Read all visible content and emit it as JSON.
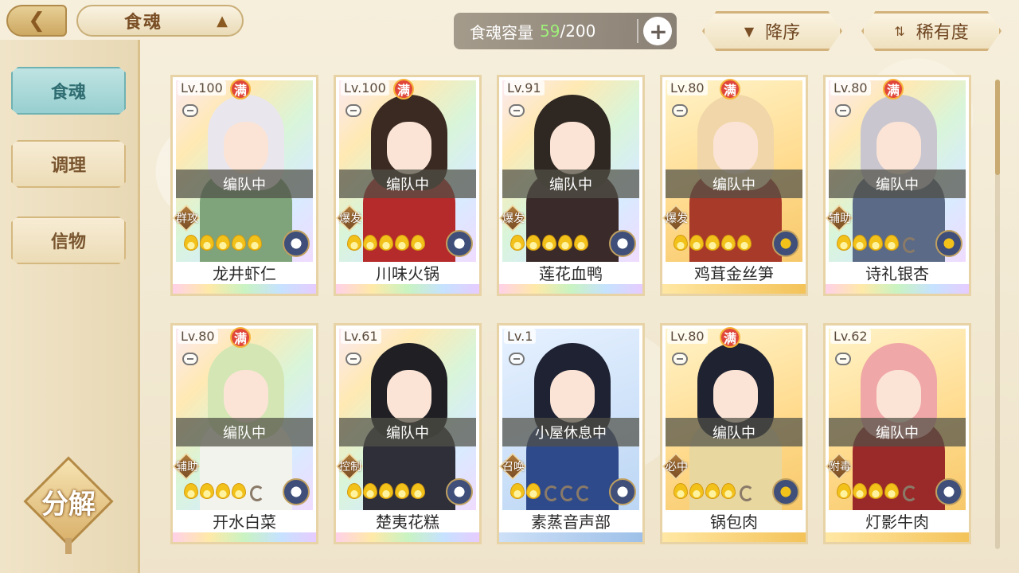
{
  "header": {
    "back_icon": "back-arrow-icon",
    "title": "食魂",
    "pagoda_icon": "pagoda-icon",
    "capacity_label": "食魂容量",
    "capacity_current": "59",
    "capacity_total": "/200",
    "add_label": "+",
    "sort_order_label": "降序",
    "sort_rarity_label": "稀有度"
  },
  "sidebar": {
    "items": [
      {
        "label": "食魂"
      },
      {
        "label": "调理"
      },
      {
        "label": "信物"
      }
    ],
    "decompose_label": "分解"
  },
  "colors": {
    "accent_teal": "#98cfd0",
    "gold": "#d2b27a",
    "capacity_green": "#9ff07a"
  },
  "cards": [
    {
      "level": "Lv.100",
      "full": "满",
      "status": "编队中",
      "role": "群攻",
      "stars": 5,
      "name": "龙井虾仁",
      "hair": "#e9e6ee",
      "body": "#7fa37a",
      "attr": "white"
    },
    {
      "level": "Lv.100",
      "full": "满",
      "status": "编队中",
      "role": "爆发",
      "stars": 5,
      "name": "川味火锅",
      "hair": "#3a2a22",
      "body": "#b52a2a",
      "attr": "white"
    },
    {
      "level": "Lv.91",
      "full": "",
      "status": "编队中",
      "role": "爆发",
      "stars": 5,
      "name": "莲花血鸭",
      "hair": "#2f2722",
      "body": "#3a2a2a",
      "attr": "white"
    },
    {
      "level": "Lv.80",
      "full": "满",
      "status": "编队中",
      "role": "爆发",
      "stars": 5,
      "name": "鸡茸金丝笋",
      "hair": "#f0d6a8",
      "body": "#a83a2a",
      "attr": "yellow"
    },
    {
      "level": "Lv.80",
      "full": "满",
      "status": "编队中",
      "role": "辅助",
      "stars": 4,
      "name": "诗礼银杏",
      "hair": "#c9c6cf",
      "body": "#5b6a86",
      "attr": "yellow"
    },
    {
      "level": "Lv.80",
      "full": "满",
      "status": "编队中",
      "role": "辅助",
      "stars": 4,
      "name": "开水白菜",
      "hair": "#d3e6b4",
      "body": "#f3f3ee",
      "attr": "white"
    },
    {
      "level": "Lv.61",
      "full": "",
      "status": "编队中",
      "role": "控制",
      "stars": 5,
      "name": "楚夷花糕",
      "hair": "#1f1f24",
      "body": "#2f2f3a",
      "attr": "white"
    },
    {
      "level": "Lv.1",
      "full": "",
      "status": "小屋休息中",
      "role": "召唤",
      "stars": 2,
      "name": "素蒸音声部",
      "hair": "#1e2233",
      "body": "#2f4a8a",
      "attr": "white"
    },
    {
      "level": "Lv.80",
      "full": "满",
      "status": "编队中",
      "role": "必中",
      "stars": 4,
      "name": "锅包肉",
      "hair": "#1f2230",
      "body": "#e9d7a0",
      "attr": "yellow"
    },
    {
      "level": "Lv.62",
      "full": "",
      "status": "编队中",
      "role": "附毒",
      "stars": 4,
      "name": "灯影牛肉",
      "hair": "#f0a7a7",
      "body": "#9a2a2a",
      "attr": "white"
    }
  ]
}
